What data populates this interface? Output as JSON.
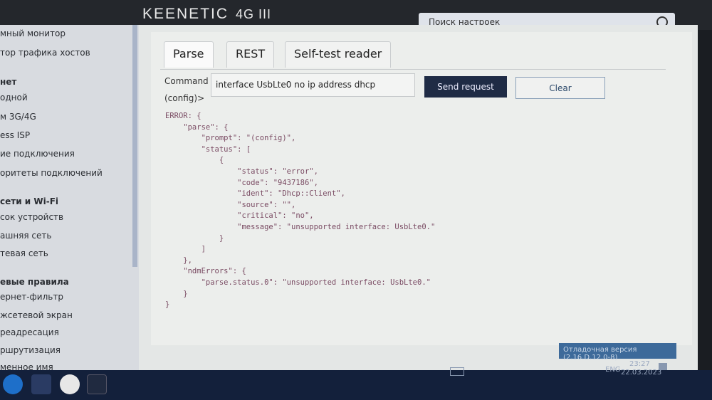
{
  "header": {
    "brand": "KEENETIC",
    "model": "4G III",
    "search_placeholder": "Поиск настроек"
  },
  "sidebar": {
    "items": [
      {
        "label": "мный монитор",
        "header": false
      },
      {
        "label": "тор трафика хостов",
        "header": false
      },
      {
        "label": "нет",
        "header": true
      },
      {
        "label": "одной",
        "header": false
      },
      {
        "label": "м 3G/4G",
        "header": false
      },
      {
        "label": "ess ISP",
        "header": false
      },
      {
        "label": "ие подключения",
        "header": false
      },
      {
        "label": "оритеты подключений",
        "header": false
      },
      {
        "label": "сети и Wi-Fi",
        "header": true
      },
      {
        "label": "сок устройств",
        "header": false
      },
      {
        "label": "ашняя сеть",
        "header": false
      },
      {
        "label": "тевая сеть",
        "header": false
      },
      {
        "label": "евые правила",
        "header": true
      },
      {
        "label": "ернет-фильтр",
        "header": false
      },
      {
        "label": "жсетевой экран",
        "header": false
      },
      {
        "label": "реадресация",
        "header": false
      },
      {
        "label": "ршрутизация",
        "header": false
      },
      {
        "label": "менное имя",
        "header": false
      }
    ]
  },
  "tabs": [
    {
      "label": "Parse",
      "active": true
    },
    {
      "label": "REST",
      "active": false
    },
    {
      "label": "Self-test reader",
      "active": false
    }
  ],
  "form": {
    "command_label": "Command",
    "prompt_label": "(config)>",
    "command_value": "interface UsbLte0 no ip address dhcp",
    "send_label": "Send request",
    "clear_label": "Clear"
  },
  "response": "ERROR: {\n    \"parse\": {\n        \"prompt\": \"(config)\",\n        \"status\": [\n            {\n                \"status\": \"error\",\n                \"code\": \"9437186\",\n                \"ident\": \"Dhcp::Client\",\n                \"source\": \"\",\n                \"critical\": \"no\",\n                \"message\": \"unsupported interface: UsbLte0.\"\n            }\n        ]\n    },\n    \"ndmErrors\": {\n        \"parse.status.0\": \"unsupported interface: UsbLte0.\"\n    }\n}",
  "debug_banner": "Отладочная версия (2.16.D.12.0-8)",
  "taskbar": {
    "lang": "ENG",
    "time": "23:27",
    "date": "22.03.2023"
  },
  "colors": {
    "send_button": "#1f2b45",
    "taskbar": "#13203b",
    "json_text": "#7a4b63"
  }
}
